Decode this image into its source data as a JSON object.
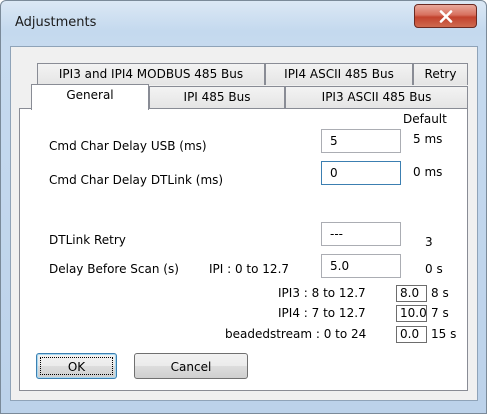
{
  "window": {
    "title": "Adjustments",
    "close_glyph": "X"
  },
  "tabs": {
    "row1": [
      "IPI3 and IPI4 MODBUS 485 Bus",
      "IPI4 ASCII 485 Bus",
      "Retry"
    ],
    "row2": [
      "General",
      "IPI 485 Bus",
      "IPI3 ASCII 485 Bus"
    ],
    "active": "General"
  },
  "general": {
    "default_header": "Default",
    "cmd_usb": {
      "label": "Cmd Char Delay USB (ms)",
      "value": "5",
      "default": "5 ms"
    },
    "cmd_dtlink": {
      "label": "Cmd Char Delay DTLink (ms)",
      "value": "0",
      "default": "0 ms"
    },
    "dtlink_retry": {
      "label": "DTLink Retry",
      "value": "---",
      "default": "3"
    },
    "delay_scan": {
      "label": "Delay Before Scan (s)",
      "ipi_range": "IPI : 0 to 12.7",
      "value": "5.0",
      "default": "0 s",
      "ipi3": {
        "range": "IPI3 : 8 to 12.7",
        "value": "8.0",
        "default": "8 s"
      },
      "ipi4": {
        "range": "IPI4 : 7 to 12.7",
        "value": "10.0",
        "default": "7 s"
      },
      "beadedstream": {
        "range": "beadedstream : 0 to 24",
        "value": "0.0",
        "default": "15 s"
      }
    }
  },
  "buttons": {
    "ok": "OK",
    "cancel": "Cancel"
  },
  "colors": {
    "frame": "#c4d9ee",
    "close_button": "#c2432e",
    "default_button_border": "#3c7fb1"
  }
}
